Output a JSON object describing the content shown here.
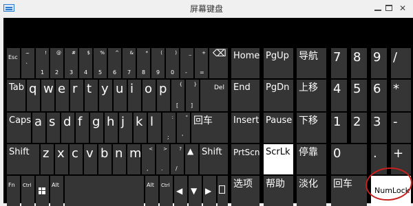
{
  "window": {
    "title": "屏幕键盘"
  },
  "keys": {
    "esc": "Esc",
    "n1": "1",
    "n2": "2",
    "n3": "3",
    "n4": "4",
    "n5": "5",
    "n6": "6",
    "n7": "7",
    "n8": "8",
    "n9": "9",
    "n0": "0",
    "s1": "!",
    "s2": "@",
    "s3": "#",
    "s4": "$",
    "s5": "%",
    "s6": "^",
    "s7": "&",
    "s8": "*",
    "s9": "(",
    "s0": ")",
    "tilde": "~",
    "backtick": "`",
    "minus": "-",
    "under": "_",
    "equal": "=",
    "plus": "+",
    "backspace": "⌫",
    "tab": "Tab",
    "q": "q",
    "w": "w",
    "e": "e",
    "r": "r",
    "t": "t",
    "y": "y",
    "u": "u",
    "i": "i",
    "o": "o",
    "p": "p",
    "lbrace": "{",
    "lbracket": "[",
    "rbrace": "}",
    "rbracket": "]",
    "del": "Del",
    "caps": "Caps",
    "a": "a",
    "s": "s",
    "d": "d",
    "f": "f",
    "g": "g",
    "h": "h",
    "j": "j",
    "k": "k",
    "l": "l",
    "colon": ":",
    "semicolon": ";",
    "quote": "\"",
    "apos": "'",
    "enter": "回车",
    "shift": "Shift",
    "z": "z",
    "x": "x",
    "c": "c",
    "v": "v",
    "b": "b",
    "n": "n",
    "m": "m",
    "lt": "<",
    "comma": ",",
    "gt": ">",
    "period": ".",
    "qmark": "?",
    "slash": "/",
    "up": "▲",
    "fn": "Fn",
    "ctrl": "Ctrl",
    "alt": "Alt",
    "left": "◀",
    "down": "▼",
    "right": "▶",
    "home": "Home",
    "pgup": "PgUp",
    "nav": "导航",
    "end": "End",
    "pgdn": "PgDn",
    "moveup": "上移",
    "insert": "Insert",
    "pause": "Pause",
    "movedown": "下移",
    "prtscn": "PrtScn",
    "scrlk": "ScrLk",
    "dock": "停靠",
    "options": "选项",
    "help": "帮助",
    "fade": "淡化",
    "np7": "7",
    "np8": "8",
    "np9": "9",
    "npslash": "/",
    "np4": "4",
    "np5": "5",
    "np6": "6",
    "npstar": "*",
    "np1": "1",
    "np2": "2",
    "np3": "3",
    "npminus": "-",
    "np0": "0",
    "npdot": ".",
    "npplus": "+",
    "npenter": "回车",
    "numlock": "NumLock"
  },
  "icons": {
    "windows_key": "windows-logo-icon",
    "menu_key": "menu-icon"
  },
  "colors": {
    "key_bg": "#353535",
    "active_key": "#ffffff",
    "keyboard_bg": "#000000",
    "annotation_circle": "#c8201e"
  }
}
